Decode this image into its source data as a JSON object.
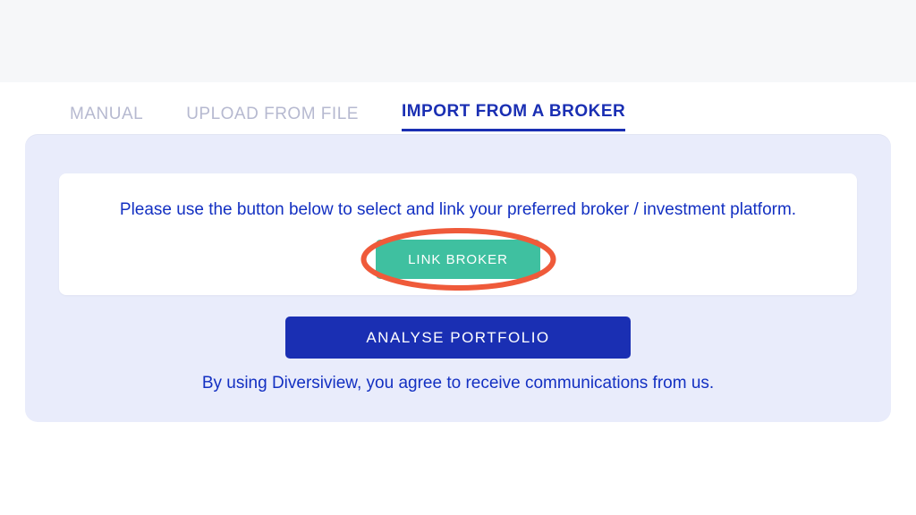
{
  "tabs": [
    {
      "label": "MANUAL",
      "active": false
    },
    {
      "label": "UPLOAD FROM FILE",
      "active": false
    },
    {
      "label": "IMPORT FROM A BROKER",
      "active": true
    }
  ],
  "panel": {
    "instruction": "Please use the button below to select and link your preferred broker / investment platform.",
    "linkBrokerLabel": "LINK BROKER",
    "analyseLabel": "ANALYSE PORTFOLIO",
    "agreementText": "By using Diversiview, you agree to receive communications from us."
  },
  "annotation": {
    "highlightColor": "#ef5a3a"
  }
}
